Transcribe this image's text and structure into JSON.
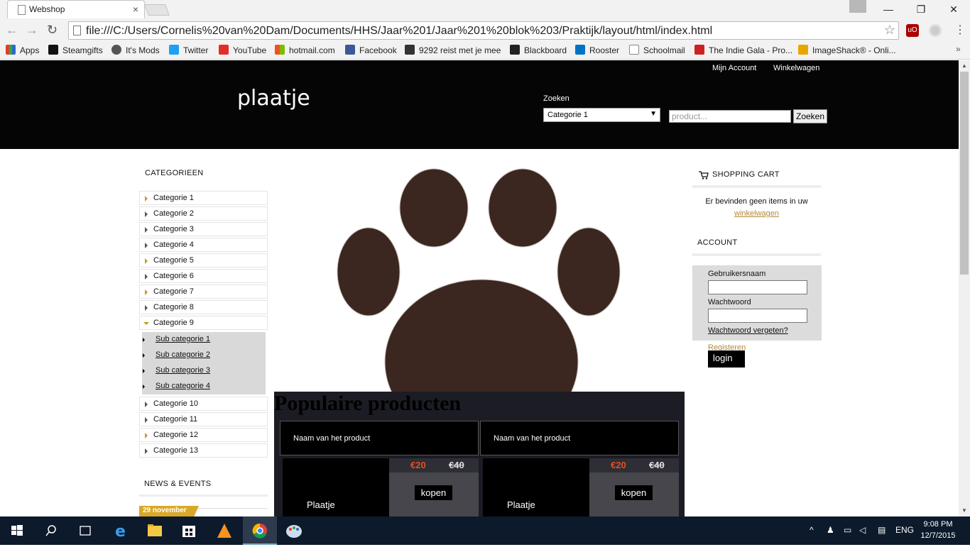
{
  "browser": {
    "tab_title": "Webshop",
    "url": "file:///C:/Users/Cornelis%20van%20Dam/Documents/HHS/Jaar%201/Jaar%201%20blok%203/Praktijk/layout/html/index.html",
    "bookmarks": [
      "Apps",
      "Steamgifts",
      "It's Mods",
      "Twitter",
      "YouTube",
      "hotmail.com",
      "Facebook",
      "9292 reist met je mee",
      "Blackboard",
      "Rooster",
      "Schoolmail",
      "The Indie Gala - Pro...",
      "ImageShack® - Onli..."
    ],
    "bookmarks_more": "»"
  },
  "header": {
    "logo": "plaatje",
    "links": {
      "account": "Mijn Account",
      "cart": "Winkelwagen"
    },
    "search": {
      "label": "Zoeken",
      "category_selected": "Categorie 1",
      "placeholder": "product...",
      "button": "Zoeken"
    }
  },
  "sidebar": {
    "categories_title": "CATEGORIEEN",
    "categories": [
      "Categorie 1",
      "Categorie 2",
      "Categorie 3",
      "Categorie 4",
      "Categorie 5",
      "Categorie 6",
      "Categorie 7",
      "Categorie 8",
      "Categorie 9"
    ],
    "subcategories": [
      "Sub categorie 1",
      "Sub categorie 2",
      "Sub categorie 3",
      "Sub categorie 4"
    ],
    "categories_after": [
      "Categorie 10",
      "Categorie 11",
      "Categorie 12",
      "Categorie 13"
    ],
    "news_title": "NEWS & EVENTS",
    "news_date": "29 november"
  },
  "main": {
    "popular_title": "Populaire producten",
    "products": [
      {
        "name": "Naam van het product",
        "image_label": "Plaatje",
        "price": "€20",
        "old_price": "€40",
        "buy_label": "kopen"
      },
      {
        "name": "Naam van het product",
        "image_label": "Plaatje",
        "price": "€20",
        "old_price": "€40",
        "buy_label": "kopen"
      }
    ]
  },
  "right": {
    "cart_title": "SHOPPING CART",
    "cart_empty_text": "Er bevinden geen items in uw",
    "cart_link": "winkelwagen",
    "account_title": "ACCOUNT",
    "username_label": "Gebruikersnaam",
    "password_label": "Wachtwoord",
    "forgot_label": "Wachtwoord vergeten?",
    "register_label": "Registeren",
    "login_label": "login"
  },
  "taskbar": {
    "language": "ENG",
    "time": "9:08 PM",
    "date": "12/7/2015"
  },
  "colors": {
    "header_bg": "#050505",
    "accent_price": "#e94e1b",
    "accent_gold": "#d9a827",
    "link_gold": "#b08a3a",
    "paw_brown": "#3b2720"
  }
}
